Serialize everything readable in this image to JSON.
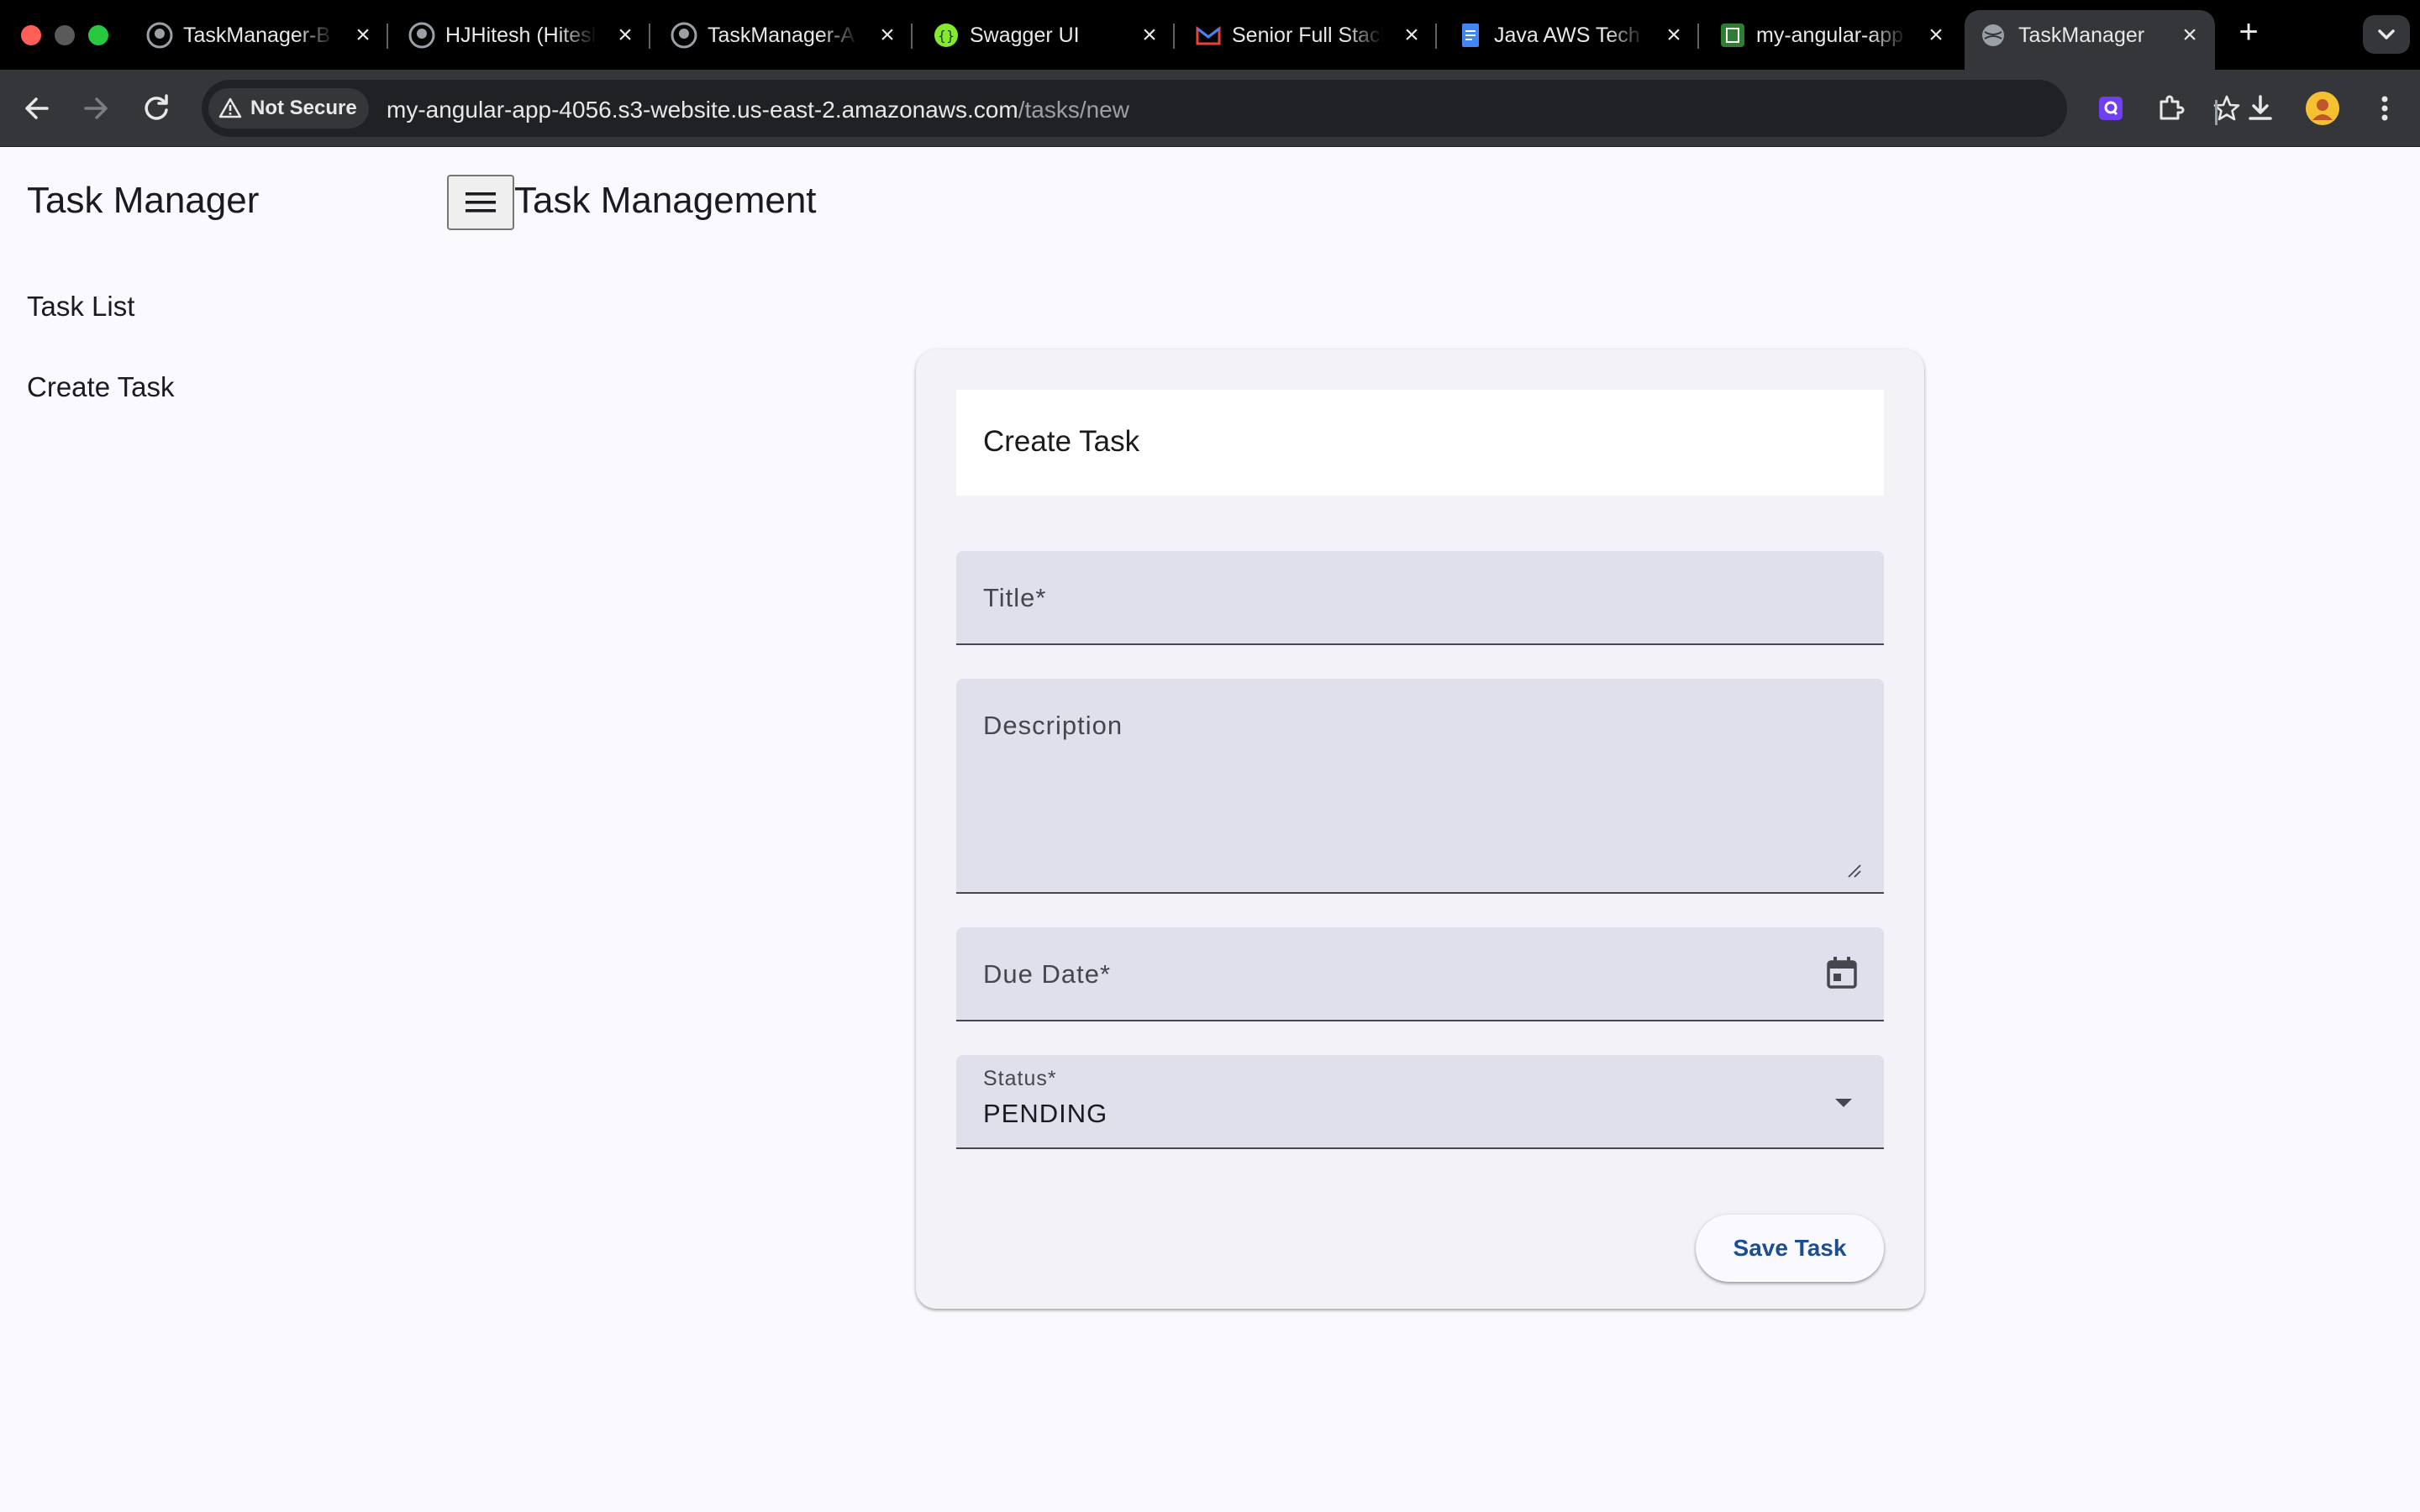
{
  "browser": {
    "tabs": [
      {
        "label": "TaskManager-B",
        "icon": "github-icon"
      },
      {
        "label": "HJHitesh (Hitesh",
        "icon": "github-icon"
      },
      {
        "label": "TaskManager-A",
        "icon": "github-icon"
      },
      {
        "label": "Swagger UI",
        "icon": "swagger-icon"
      },
      {
        "label": "Senior Full Stack",
        "icon": "gmail-icon"
      },
      {
        "label": "Java AWS Tech",
        "icon": "docs-icon"
      },
      {
        "label": "my-angular-app",
        "icon": "angular-icon"
      },
      {
        "label": "TaskManager",
        "icon": "globe-icon",
        "active": true
      }
    ],
    "security_label": "Not Secure",
    "url_host": "my-angular-app-4056.s3-website.us-east-2.amazonaws.com",
    "url_path": "/tasks/new"
  },
  "app": {
    "title": "Task Manager",
    "header_title": "Task Management",
    "nav": {
      "task_list": "Task List",
      "create_task": "Create Task"
    }
  },
  "form": {
    "card_title": "Create Task",
    "title_label": "Title*",
    "description_label": "Description",
    "due_date_label": "Due Date*",
    "status_label": "Status*",
    "status_value": "PENDING",
    "save_label": "Save Task"
  },
  "colors": {
    "field_background": "#dfe0eb",
    "page_background": "#faf9fd",
    "primary_text": "#1d4e8f"
  }
}
